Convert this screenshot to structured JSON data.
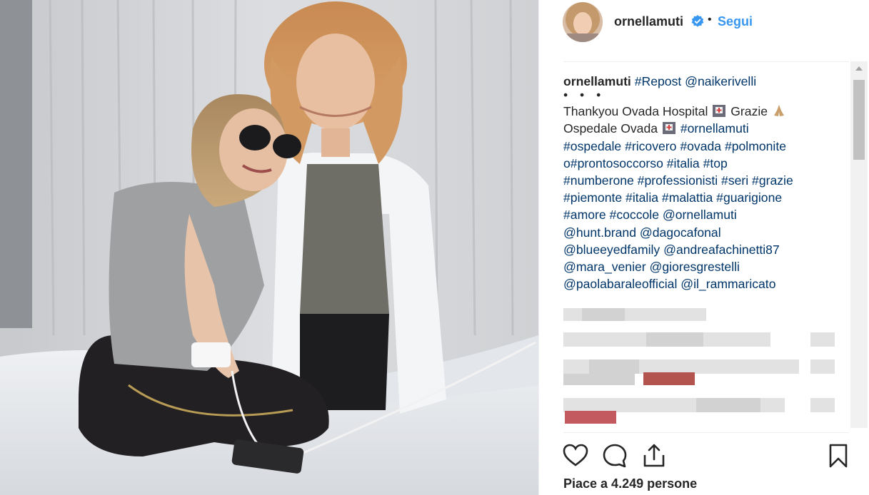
{
  "photo": {
    "icon": "post-photo",
    "alt_subject": "two women in hospital room"
  },
  "post": {
    "username": "ornellamuti",
    "verified_icon": "verified-badge-icon",
    "separator": "•",
    "follow_label": "Segui"
  },
  "caption": {
    "author": "ornellamuti",
    "repost_tag": "#Repost",
    "repost_user": "@naikerivelli",
    "ellipsis_dots": "• • •",
    "line1_text": "Thankyou Ovada Hospital",
    "line1_text2": "Grazie",
    "line2_text": "Ospedale Ovada",
    "line2_tag": "#ornellamuti",
    "tags_lines": [
      "#ospedale #ricovero #ovada #polmonite",
      "o#prontosoccorso #italia #top",
      "#numberone #professionisti #seri #grazie",
      "#piemonte #italia #malattia #guarigione",
      "#amore #coccole @ornellamuti",
      "@hunt.brand @dagocafonal",
      "@blueeyedfamily @andreafachinetti87",
      "@mara_venier @gioresgrestelli",
      "@paolabaraleofficial @il_rammaricato"
    ],
    "emoji_icons": [
      "hospital-emoji-icon",
      "praying-hands-emoji-icon",
      "hospital-emoji-icon"
    ]
  },
  "actions": {
    "like_icon": "heart-icon",
    "comment_icon": "comment-bubble-icon",
    "share_icon": "share-upload-icon",
    "save_icon": "bookmark-icon",
    "likes_text": "Piace a 4.249 persone"
  },
  "colors": {
    "link": "#3897f0",
    "hashtag": "#003569",
    "text": "#262626",
    "divider": "#efefef"
  }
}
